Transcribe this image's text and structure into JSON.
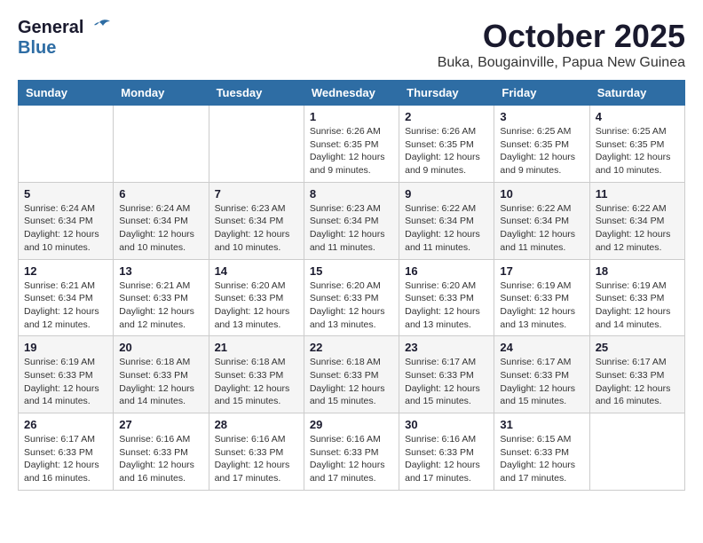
{
  "header": {
    "logo_general": "General",
    "logo_blue": "Blue",
    "month_title": "October 2025",
    "location": "Buka, Bougainville, Papua New Guinea"
  },
  "days_of_week": [
    "Sunday",
    "Monday",
    "Tuesday",
    "Wednesday",
    "Thursday",
    "Friday",
    "Saturday"
  ],
  "weeks": [
    [
      {
        "day": "",
        "info": ""
      },
      {
        "day": "",
        "info": ""
      },
      {
        "day": "",
        "info": ""
      },
      {
        "day": "1",
        "info": "Sunrise: 6:26 AM\nSunset: 6:35 PM\nDaylight: 12 hours and 9 minutes."
      },
      {
        "day": "2",
        "info": "Sunrise: 6:26 AM\nSunset: 6:35 PM\nDaylight: 12 hours and 9 minutes."
      },
      {
        "day": "3",
        "info": "Sunrise: 6:25 AM\nSunset: 6:35 PM\nDaylight: 12 hours and 9 minutes."
      },
      {
        "day": "4",
        "info": "Sunrise: 6:25 AM\nSunset: 6:35 PM\nDaylight: 12 hours and 10 minutes."
      }
    ],
    [
      {
        "day": "5",
        "info": "Sunrise: 6:24 AM\nSunset: 6:34 PM\nDaylight: 12 hours and 10 minutes."
      },
      {
        "day": "6",
        "info": "Sunrise: 6:24 AM\nSunset: 6:34 PM\nDaylight: 12 hours and 10 minutes."
      },
      {
        "day": "7",
        "info": "Sunrise: 6:23 AM\nSunset: 6:34 PM\nDaylight: 12 hours and 10 minutes."
      },
      {
        "day": "8",
        "info": "Sunrise: 6:23 AM\nSunset: 6:34 PM\nDaylight: 12 hours and 11 minutes."
      },
      {
        "day": "9",
        "info": "Sunrise: 6:22 AM\nSunset: 6:34 PM\nDaylight: 12 hours and 11 minutes."
      },
      {
        "day": "10",
        "info": "Sunrise: 6:22 AM\nSunset: 6:34 PM\nDaylight: 12 hours and 11 minutes."
      },
      {
        "day": "11",
        "info": "Sunrise: 6:22 AM\nSunset: 6:34 PM\nDaylight: 12 hours and 12 minutes."
      }
    ],
    [
      {
        "day": "12",
        "info": "Sunrise: 6:21 AM\nSunset: 6:34 PM\nDaylight: 12 hours and 12 minutes."
      },
      {
        "day": "13",
        "info": "Sunrise: 6:21 AM\nSunset: 6:33 PM\nDaylight: 12 hours and 12 minutes."
      },
      {
        "day": "14",
        "info": "Sunrise: 6:20 AM\nSunset: 6:33 PM\nDaylight: 12 hours and 13 minutes."
      },
      {
        "day": "15",
        "info": "Sunrise: 6:20 AM\nSunset: 6:33 PM\nDaylight: 12 hours and 13 minutes."
      },
      {
        "day": "16",
        "info": "Sunrise: 6:20 AM\nSunset: 6:33 PM\nDaylight: 12 hours and 13 minutes."
      },
      {
        "day": "17",
        "info": "Sunrise: 6:19 AM\nSunset: 6:33 PM\nDaylight: 12 hours and 13 minutes."
      },
      {
        "day": "18",
        "info": "Sunrise: 6:19 AM\nSunset: 6:33 PM\nDaylight: 12 hours and 14 minutes."
      }
    ],
    [
      {
        "day": "19",
        "info": "Sunrise: 6:19 AM\nSunset: 6:33 PM\nDaylight: 12 hours and 14 minutes."
      },
      {
        "day": "20",
        "info": "Sunrise: 6:18 AM\nSunset: 6:33 PM\nDaylight: 12 hours and 14 minutes."
      },
      {
        "day": "21",
        "info": "Sunrise: 6:18 AM\nSunset: 6:33 PM\nDaylight: 12 hours and 15 minutes."
      },
      {
        "day": "22",
        "info": "Sunrise: 6:18 AM\nSunset: 6:33 PM\nDaylight: 12 hours and 15 minutes."
      },
      {
        "day": "23",
        "info": "Sunrise: 6:17 AM\nSunset: 6:33 PM\nDaylight: 12 hours and 15 minutes."
      },
      {
        "day": "24",
        "info": "Sunrise: 6:17 AM\nSunset: 6:33 PM\nDaylight: 12 hours and 15 minutes."
      },
      {
        "day": "25",
        "info": "Sunrise: 6:17 AM\nSunset: 6:33 PM\nDaylight: 12 hours and 16 minutes."
      }
    ],
    [
      {
        "day": "26",
        "info": "Sunrise: 6:17 AM\nSunset: 6:33 PM\nDaylight: 12 hours and 16 minutes."
      },
      {
        "day": "27",
        "info": "Sunrise: 6:16 AM\nSunset: 6:33 PM\nDaylight: 12 hours and 16 minutes."
      },
      {
        "day": "28",
        "info": "Sunrise: 6:16 AM\nSunset: 6:33 PM\nDaylight: 12 hours and 17 minutes."
      },
      {
        "day": "29",
        "info": "Sunrise: 6:16 AM\nSunset: 6:33 PM\nDaylight: 12 hours and 17 minutes."
      },
      {
        "day": "30",
        "info": "Sunrise: 6:16 AM\nSunset: 6:33 PM\nDaylight: 12 hours and 17 minutes."
      },
      {
        "day": "31",
        "info": "Sunrise: 6:15 AM\nSunset: 6:33 PM\nDaylight: 12 hours and 17 minutes."
      },
      {
        "day": "",
        "info": ""
      }
    ]
  ]
}
